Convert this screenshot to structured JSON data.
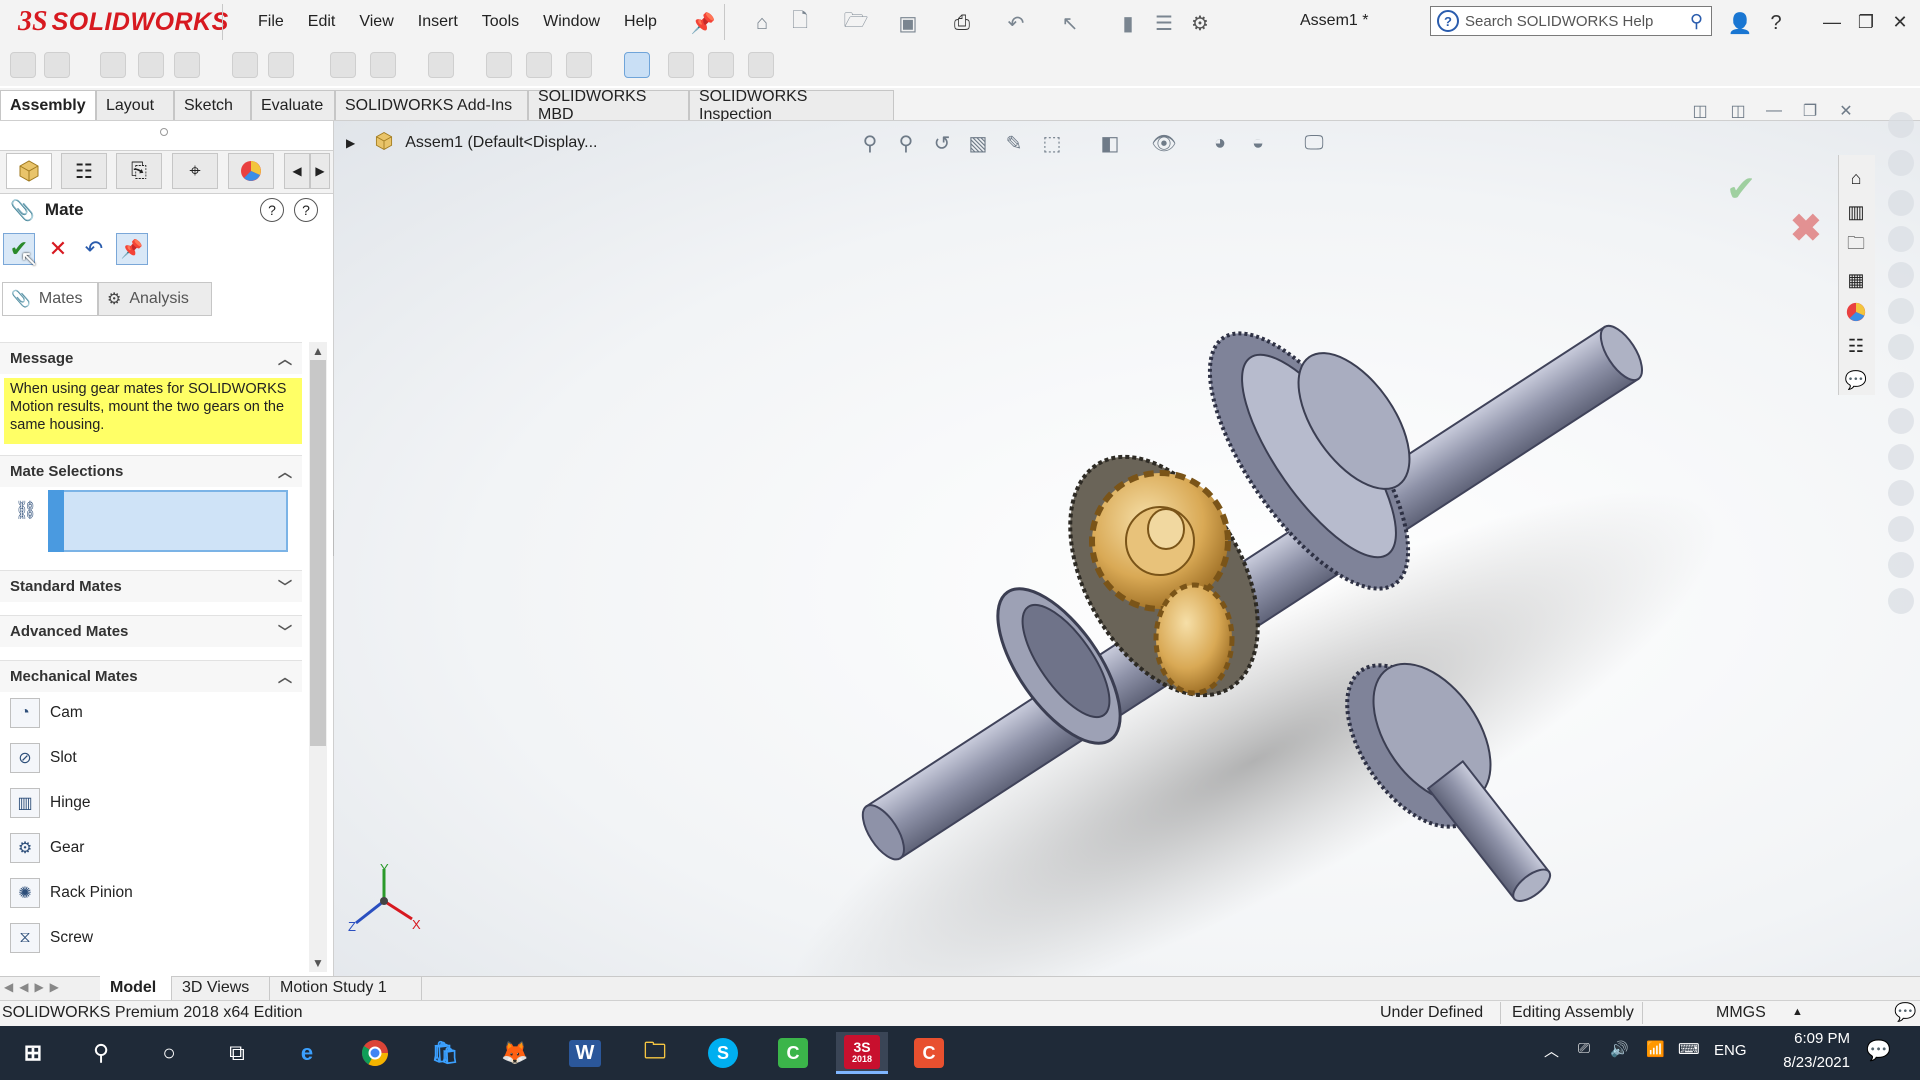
{
  "app": {
    "logo_ds": "3S",
    "logo_text": "SOLIDWORKS",
    "doc_title": "Assem1 *",
    "menu": [
      "File",
      "Edit",
      "View",
      "Insert",
      "Tools",
      "Window",
      "Help"
    ],
    "search_placeholder": "Search SOLIDWORKS Help"
  },
  "command_tabs": [
    "Assembly",
    "Layout",
    "Sketch",
    "Evaluate",
    "SOLIDWORKS Add-Ins",
    "SOLIDWORKS MBD",
    "SOLIDWORKS Inspection"
  ],
  "property_manager": {
    "title": "Mate",
    "subtabs": [
      "Mates",
      "Analysis"
    ],
    "message_header": "Message",
    "message_text": "When using gear mates for SOLIDWORKS Motion results, mount the two gears on the same housing.",
    "mate_selections": "Mate Selections",
    "standard_mates": "Standard Mates",
    "advanced_mates": "Advanced Mates",
    "mechanical_mates": "Mechanical Mates",
    "mechanical_items": [
      "Cam",
      "Slot",
      "Hinge",
      "Gear",
      "Rack Pinion",
      "Screw"
    ]
  },
  "viewport": {
    "breadcrumb": "Assem1  (Default<Display...",
    "triad": {
      "x": "X",
      "y": "Y",
      "z": "Z"
    }
  },
  "bottom_tabs": [
    "Model",
    "3D Views",
    "Motion Study 1"
  ],
  "status": {
    "edition": "SOLIDWORKS Premium 2018 x64 Edition",
    "under_defined": "Under Defined",
    "editing": "Editing Assembly",
    "units": "MMGS"
  },
  "taskbar": {
    "lang": "ENG",
    "time": "6:09 PM",
    "date": "8/23/2021",
    "sw_badge": "2018"
  },
  "colors": {
    "brand_red": "#d71920",
    "message_yellow": "#ffff66",
    "selection_blue": "#cfe3f7",
    "taskbar": "#1f2a38"
  }
}
